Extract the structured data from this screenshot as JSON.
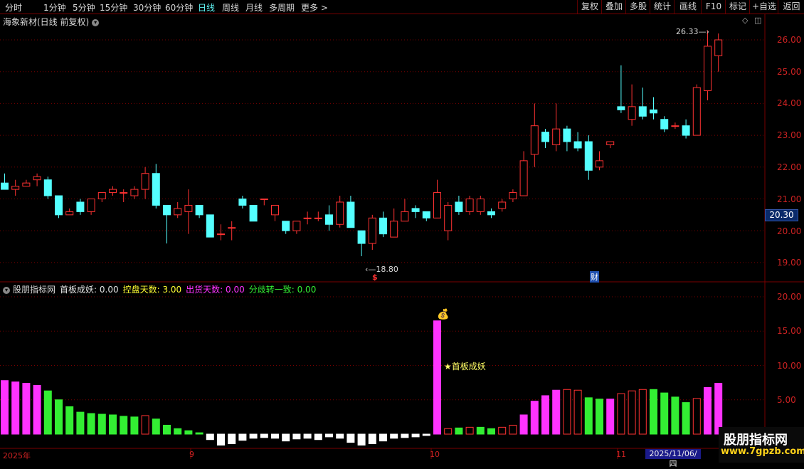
{
  "toolbar": {
    "periods": [
      "分时",
      "1分钟",
      "5分钟",
      "15分钟",
      "30分钟",
      "60分钟",
      "日线",
      "周线",
      "月线",
      "多周期",
      "更多 >"
    ],
    "active_period": "日线",
    "right_buttons": [
      "复权",
      "叠加",
      "多股",
      "统计",
      "画线",
      "F10",
      "标记",
      "+自选",
      "返回"
    ]
  },
  "chart_title": "海象新材(日线 前复权)",
  "indicator": {
    "name": "股朋指标网",
    "values": [
      {
        "label": "首板成妖: 0.00",
        "color": "#e0e0e0"
      },
      {
        "label": "控盘天数: 3.00",
        "color": "#ffff33"
      },
      {
        "label": "出货天数: 0.00",
        "color": "#ff33ff"
      },
      {
        "label": "分歧转一致: 0.00",
        "color": "#33ee33"
      }
    ],
    "signal_label": "★首板成妖"
  },
  "price_axis": [
    "26.00",
    "25.00",
    "24.00",
    "23.00",
    "22.00",
    "21.00",
    "20.00",
    "19.00"
  ],
  "indicator_axis": [
    "20.00",
    "15.00",
    "10.00",
    "5.00"
  ],
  "current_price": "20.30",
  "high_label": "26.33",
  "low_label": "18.80",
  "marker_s": "$",
  "marker_cai": "财",
  "date_labels": [
    "2025年",
    "9",
    "10",
    "11"
  ],
  "cursor_date": "2025/11/06/四",
  "watermark": {
    "cn": "股朋指标网",
    "url": "www.7gpzb.com"
  },
  "colors": {
    "up": "#ff3232",
    "down": "#54ffff",
    "grid": "#7a0000",
    "magenta": "#ff33ff",
    "green": "#33ee33"
  },
  "chart_data": {
    "type": "candlestick",
    "candles": [
      [
        21.5,
        21.3,
        21.8,
        21.3
      ],
      [
        21.3,
        21.4,
        21.6,
        21.1
      ],
      [
        21.4,
        21.5,
        21.6,
        21.4
      ],
      [
        21.6,
        21.7,
        21.8,
        21.4
      ],
      [
        21.6,
        21.1,
        21.7,
        21.0
      ],
      [
        21.1,
        20.5,
        21.1,
        20.4
      ],
      [
        20.5,
        20.6,
        20.7,
        20.5
      ],
      [
        20.9,
        20.6,
        21.0,
        20.5
      ],
      [
        20.6,
        21.0,
        21.0,
        20.5
      ],
      [
        21.0,
        21.2,
        21.2,
        20.9
      ],
      [
        21.2,
        21.3,
        21.4,
        21.1
      ],
      [
        21.2,
        21.2,
        21.3,
        20.9
      ],
      [
        21.1,
        21.3,
        21.4,
        21.0
      ],
      [
        21.3,
        21.8,
        22.0,
        21.0
      ],
      [
        21.8,
        20.8,
        22.1,
        20.7
      ],
      [
        20.8,
        20.5,
        20.8,
        19.6
      ],
      [
        20.5,
        20.7,
        20.9,
        20.4
      ],
      [
        20.6,
        20.8,
        21.3,
        19.9
      ],
      [
        20.8,
        20.5,
        20.8,
        20.4
      ],
      [
        20.5,
        19.8,
        20.5,
        19.8
      ],
      [
        19.9,
        19.9,
        20.2,
        19.7
      ],
      [
        20.1,
        20.1,
        20.3,
        19.7
      ],
      [
        21.0,
        20.8,
        21.1,
        20.7
      ],
      [
        20.8,
        20.3,
        20.8,
        20.3
      ],
      [
        21.0,
        21.0,
        21.0,
        20.8
      ],
      [
        20.5,
        20.8,
        20.8,
        20.3
      ],
      [
        20.3,
        20.0,
        20.3,
        19.9
      ],
      [
        20.0,
        20.3,
        20.3,
        19.9
      ],
      [
        20.4,
        20.4,
        20.6,
        20.2
      ],
      [
        20.4,
        20.4,
        20.6,
        20.3
      ],
      [
        20.5,
        20.2,
        20.8,
        20.0
      ],
      [
        20.2,
        20.9,
        21.1,
        20.1
      ],
      [
        20.9,
        20.1,
        21.1,
        20.1
      ],
      [
        20.0,
        19.6,
        20.0,
        19.2
      ],
      [
        19.6,
        20.4,
        20.5,
        19.4
      ],
      [
        20.4,
        19.9,
        20.6,
        19.8
      ],
      [
        19.8,
        20.3,
        20.7,
        19.8
      ],
      [
        20.3,
        20.6,
        21.0,
        20.3
      ],
      [
        20.7,
        20.6,
        20.8,
        20.4
      ],
      [
        20.6,
        20.4,
        20.6,
        20.3
      ],
      [
        20.4,
        21.2,
        21.6,
        20.4
      ],
      [
        20.0,
        20.8,
        20.9,
        19.7
      ],
      [
        20.9,
        20.6,
        21.1,
        20.5
      ],
      [
        20.6,
        21.0,
        21.1,
        20.5
      ],
      [
        20.6,
        21.0,
        21.1,
        20.5
      ],
      [
        20.6,
        20.5,
        20.7,
        20.4
      ],
      [
        20.7,
        20.9,
        21.0,
        20.6
      ],
      [
        21.0,
        21.2,
        21.3,
        20.9
      ],
      [
        21.1,
        22.2,
        22.5,
        21.1
      ],
      [
        22.4,
        23.3,
        24.0,
        22.0
      ],
      [
        23.1,
        22.8,
        23.2,
        22.6
      ],
      [
        22.7,
        23.2,
        24.0,
        22.5
      ],
      [
        23.2,
        22.8,
        23.3,
        22.5
      ],
      [
        22.8,
        22.6,
        23.1,
        22.5
      ],
      [
        22.8,
        21.9,
        23.0,
        21.6
      ],
      [
        22.0,
        22.2,
        22.5,
        21.9
      ],
      [
        22.7,
        22.8,
        22.8,
        22.6
      ],
      [
        23.9,
        23.8,
        25.2,
        23.7
      ],
      [
        23.5,
        23.9,
        24.6,
        23.3
      ],
      [
        23.9,
        23.6,
        24.5,
        23.5
      ],
      [
        23.8,
        23.7,
        24.2,
        23.5
      ],
      [
        23.5,
        23.2,
        23.6,
        23.1
      ],
      [
        23.3,
        23.3,
        23.4,
        23.2
      ],
      [
        23.3,
        23.0,
        23.5,
        22.9
      ],
      [
        23.0,
        24.5,
        24.6,
        23.0
      ],
      [
        24.4,
        25.8,
        26.3,
        24.1
      ],
      [
        25.5,
        26.0,
        26.2,
        25.0
      ]
    ],
    "indicator_bars": [
      [
        7.8,
        "mag"
      ],
      [
        7.6,
        "mag"
      ],
      [
        7.4,
        "mag"
      ],
      [
        7.1,
        "mag"
      ],
      [
        6.3,
        "grn"
      ],
      [
        5.0,
        "grn"
      ],
      [
        4.0,
        "grn"
      ],
      [
        3.2,
        "grn"
      ],
      [
        3.0,
        "grn"
      ],
      [
        2.9,
        "grn"
      ],
      [
        2.8,
        "grn"
      ],
      [
        2.6,
        "grn"
      ],
      [
        2.5,
        "grn"
      ],
      [
        2.7,
        "red"
      ],
      [
        2.2,
        "grn"
      ],
      [
        1.3,
        "grn"
      ],
      [
        0.8,
        "grn"
      ],
      [
        0.5,
        "grn"
      ],
      [
        0.2,
        "grn"
      ],
      [
        -0.8,
        "wht"
      ],
      [
        -1.6,
        "wht"
      ],
      [
        -1.4,
        "wht"
      ],
      [
        -0.9,
        "wht"
      ],
      [
        -0.6,
        "wht"
      ],
      [
        -0.5,
        "wht"
      ],
      [
        -0.6,
        "wht"
      ],
      [
        -1.0,
        "wht"
      ],
      [
        -0.7,
        "wht"
      ],
      [
        -0.6,
        "wht"
      ],
      [
        -0.8,
        "wht"
      ],
      [
        -0.4,
        "wht"
      ],
      [
        -0.6,
        "wht"
      ],
      [
        -1.2,
        "wht"
      ],
      [
        -1.6,
        "wht"
      ],
      [
        -1.4,
        "wht"
      ],
      [
        -1.0,
        "wht"
      ],
      [
        -0.6,
        "wht"
      ],
      [
        -0.5,
        "wht"
      ],
      [
        -0.4,
        "wht"
      ],
      [
        -0.2,
        "wht"
      ],
      [
        16.5,
        "mag"
      ],
      [
        0.8,
        "red"
      ],
      [
        0.9,
        "grn"
      ],
      [
        1.0,
        "red"
      ],
      [
        1.0,
        "grn"
      ],
      [
        0.8,
        "grn"
      ],
      [
        1.0,
        "red"
      ],
      [
        1.3,
        "red"
      ],
      [
        2.8,
        "mag"
      ],
      [
        4.8,
        "mag"
      ],
      [
        5.6,
        "mag"
      ],
      [
        6.4,
        "mag"
      ],
      [
        6.5,
        "red"
      ],
      [
        6.4,
        "red"
      ],
      [
        5.3,
        "grn"
      ],
      [
        5.1,
        "grn"
      ],
      [
        5.1,
        "mag"
      ],
      [
        5.9,
        "red"
      ],
      [
        6.3,
        "red"
      ],
      [
        6.5,
        "red"
      ],
      [
        6.5,
        "grn"
      ],
      [
        6.0,
        "grn"
      ],
      [
        5.4,
        "grn"
      ],
      [
        4.6,
        "grn"
      ],
      [
        5.2,
        "red"
      ],
      [
        6.8,
        "mag"
      ],
      [
        7.4,
        "mag"
      ]
    ],
    "price_range": [
      18.5,
      26.4
    ],
    "indicator_range": [
      -2,
      21
    ]
  }
}
